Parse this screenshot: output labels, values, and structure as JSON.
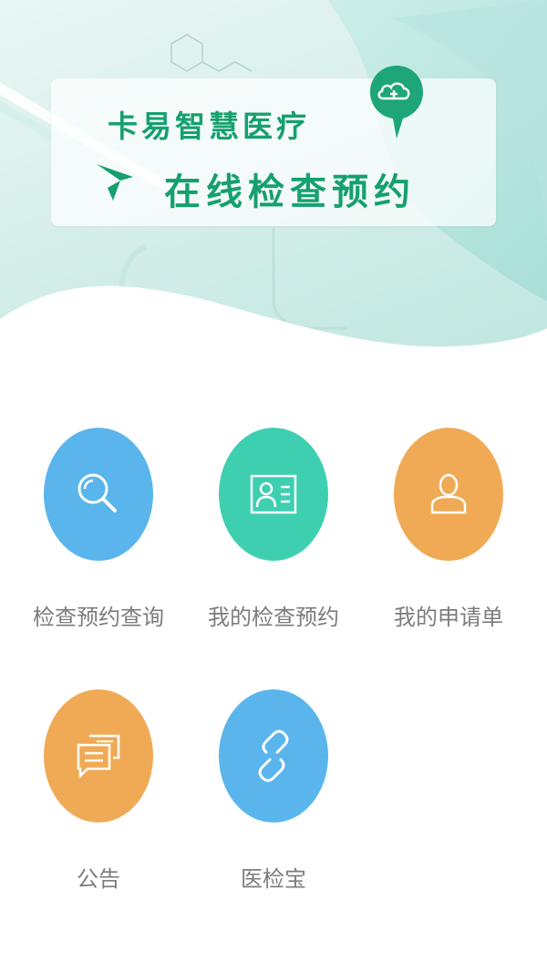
{
  "banner": {
    "brand": "卡易智慧医疗",
    "subtitle": "在线检查预约"
  },
  "menu": [
    {
      "label": "检查预约查询",
      "icon": "search-icon",
      "color": "#5ab5ec"
    },
    {
      "label": "我的检查预约",
      "icon": "id-card-icon",
      "color": "#3ecfb0"
    },
    {
      "label": "我的申请单",
      "icon": "user-icon",
      "color": "#f0aa55"
    },
    {
      "label": "公告",
      "icon": "notice-icon",
      "color": "#f0aa55"
    },
    {
      "label": "医检宝",
      "icon": "link-icon",
      "color": "#5ab5ec"
    }
  ]
}
